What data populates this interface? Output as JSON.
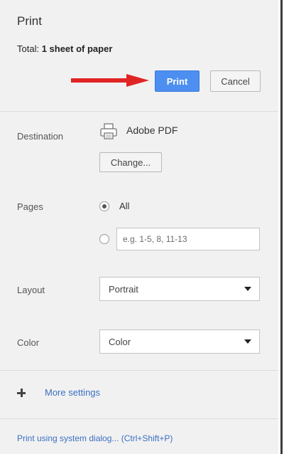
{
  "dialog": {
    "title": "Print",
    "total_prefix": "Total: ",
    "total_value": "1 sheet of paper",
    "print_label": "Print",
    "cancel_label": "Cancel"
  },
  "destination": {
    "label": "Destination",
    "name": "Adobe PDF",
    "change_label": "Change..."
  },
  "pages": {
    "label": "Pages",
    "all_label": "All",
    "custom_placeholder": "e.g. 1-5, 8, 11-13",
    "custom_value": ""
  },
  "layout": {
    "label": "Layout",
    "selected": "Portrait"
  },
  "color": {
    "label": "Color",
    "selected": "Color"
  },
  "more_settings": {
    "label": "More settings"
  },
  "system_dialog": {
    "label": "Print using system dialog... (Ctrl+Shift+P)"
  },
  "colors": {
    "accent": "#4d8ff0",
    "arrow": "#e02424",
    "link": "#3b6fc3"
  }
}
